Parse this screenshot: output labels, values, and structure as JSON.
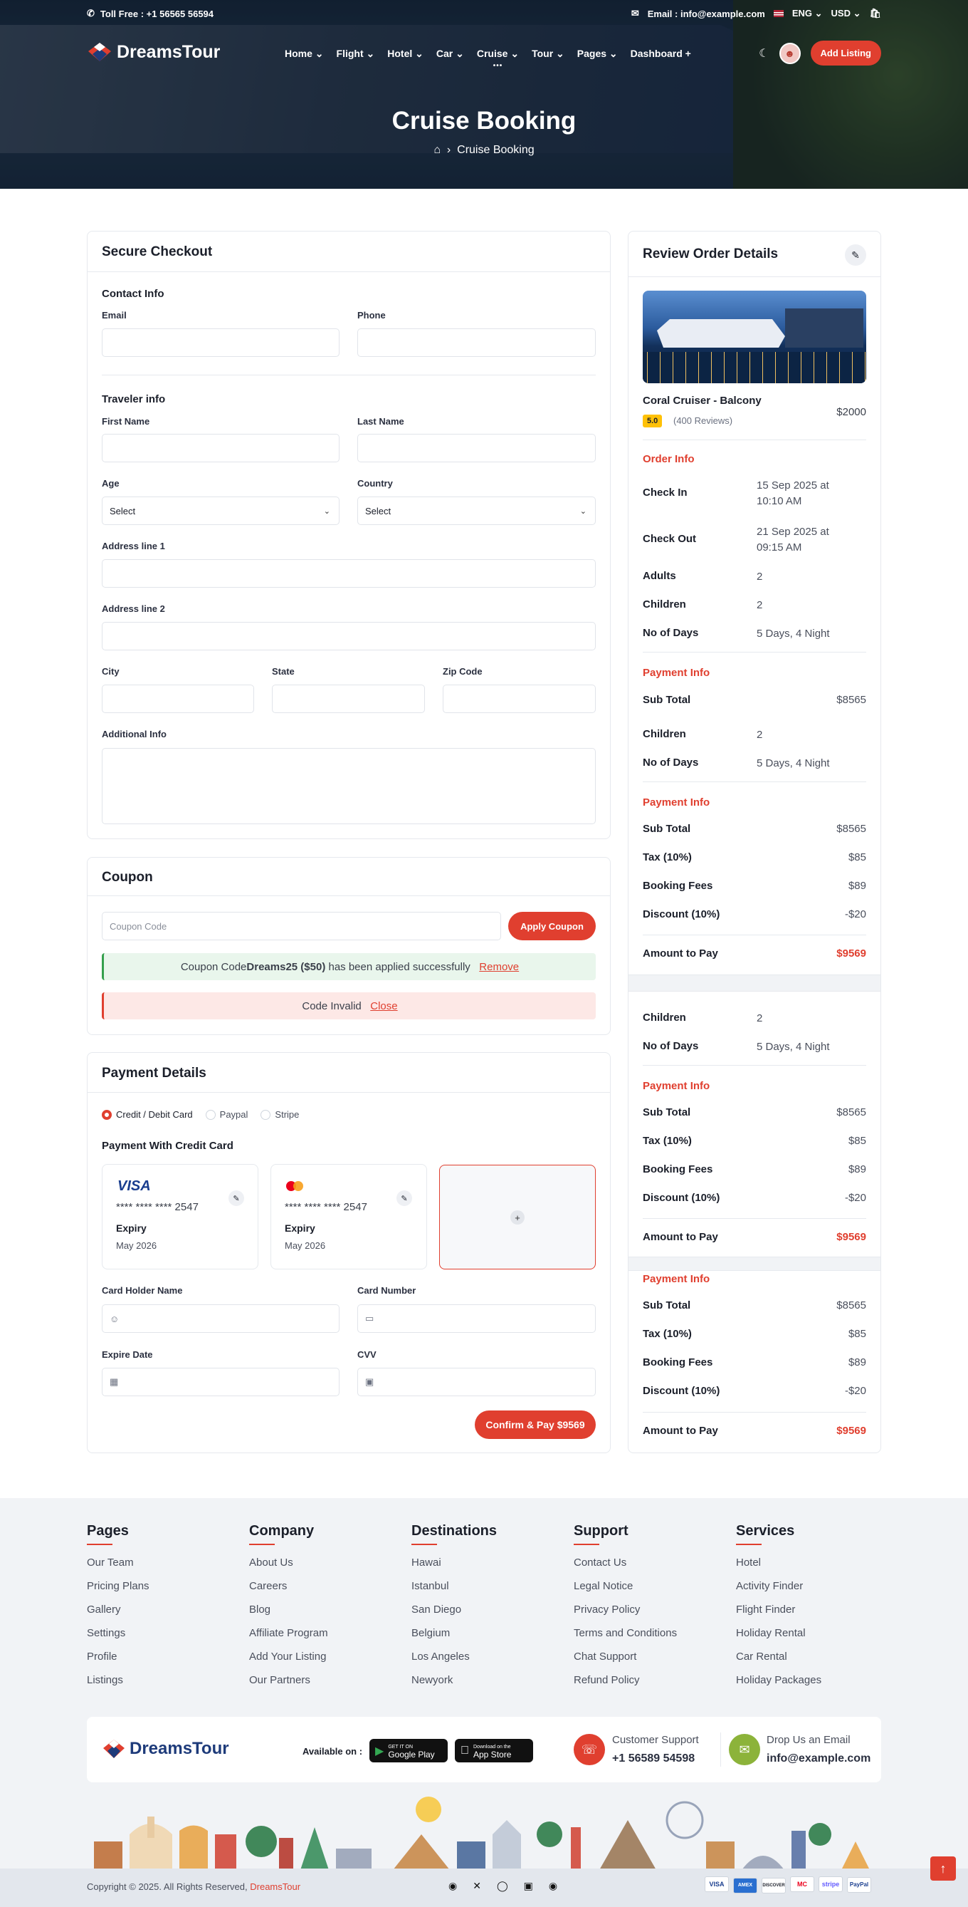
{
  "topbar": {
    "phone": "Toll Free : +1 56565 56594",
    "email": "Email : info@example.com",
    "language": "ENG",
    "currency": "USD"
  },
  "header": {
    "logo": "DreamsTour",
    "menu": [
      "Home",
      "Flight",
      "Hotel",
      "Car",
      "Cruise",
      "Tour",
      "Pages",
      "Dashboard"
    ],
    "add_listing": "Add Listing"
  },
  "hero": {
    "title": "Cruise Booking",
    "breadcrumb": "Cruise Booking"
  },
  "checkout": {
    "title": "Secure Checkout",
    "contact_title": "Contact Info",
    "email_label": "Email",
    "phone_label": "Phone",
    "traveler_title": "Traveler info",
    "first_name_label": "First Name",
    "last_name_label": "Last Name",
    "age_label": "Age",
    "age_value": "Select",
    "country_label": "Country",
    "country_value": "Select",
    "address1_label": "Address line 1",
    "address2_label": "Address line 2",
    "city_label": "City",
    "state_label": "State",
    "zip_label": "Zip Code",
    "additional_label": "Additional Info"
  },
  "coupon": {
    "title": "Coupon",
    "placeholder": "Coupon Code",
    "apply": "Apply Coupon",
    "success_prefix": "Coupon Code ",
    "success_code": "Dreams25 ($50)",
    "success_suffix": " has been applied successfully",
    "remove": "Remove",
    "invalid": "Code Invalid",
    "close": "Close"
  },
  "payment": {
    "title": "Payment Details",
    "methods": [
      "Credit / Debit Card",
      "Paypal",
      "Stripe"
    ],
    "selected_method": "Credit / Debit Card",
    "subtitle": "Payment With Credit Card",
    "cards": [
      {
        "brand": "VISA",
        "number": "**** **** **** 2547",
        "expiry_label": "Expiry",
        "expiry": "May 2026"
      },
      {
        "brand": "mastercard",
        "number": "**** **** **** 2547",
        "expiry_label": "Expiry",
        "expiry": "May 2026"
      }
    ],
    "holder_label": "Card Holder Name",
    "number_label": "Card Number",
    "expire_label": "Expire Date",
    "cvv_label": "CVV",
    "confirm": "Confirm & Pay $9569"
  },
  "order": {
    "title": "Review Order Details",
    "name": "Coral Cruiser - Balcony",
    "rating": "5.0",
    "reviews": "(400 Reviews)",
    "price": "$2000",
    "order_info_title": "Order Info",
    "checkin_label": "Check In",
    "checkin_value": "15 Sep 2025 at 10:10 AM",
    "checkout_label": "Check Out",
    "checkout_value": "21 Sep 2025 at 09:15 AM",
    "adults_label": "Adults",
    "adults_value": "2",
    "children_label": "Children",
    "children_value": "2",
    "days_label": "No of Days",
    "days_value": "5 Days, 4 Night",
    "payment_info_title": "Payment Info",
    "subtotal_label": "Sub Total",
    "subtotal_value": "$8565",
    "tax_label": "Tax (10%)",
    "tax_value": "$85",
    "fees_label": "Booking Fees",
    "fees_value": "$89",
    "discount_label": "Discount (10%)",
    "discount_value": "-$20",
    "amount_label": "Amount to Pay",
    "amount_value": "$9569"
  },
  "footer": {
    "columns": [
      {
        "title": "Pages",
        "items": [
          "Our Team",
          "Pricing Plans",
          "Gallery",
          "Settings",
          "Profile",
          "Listings"
        ]
      },
      {
        "title": "Company",
        "items": [
          "About Us",
          "Careers",
          "Blog",
          "Affiliate Program",
          "Add Your Listing",
          "Our Partners"
        ]
      },
      {
        "title": "Destinations",
        "items": [
          "Hawai",
          "Istanbul",
          "San Diego",
          "Belgium",
          "Los Angeles",
          "Newyork"
        ]
      },
      {
        "title": "Support",
        "items": [
          "Contact Us",
          "Legal Notice",
          "Privacy Policy",
          "Terms and Conditions",
          "Chat Support",
          "Refund Policy"
        ]
      },
      {
        "title": "Services",
        "items": [
          "Hotel",
          "Activity Finder",
          "Flight Finder",
          "Holiday Rental",
          "Car Rental",
          "Holiday Packages"
        ]
      }
    ],
    "logo": "DreamsTour",
    "available_on": "Available on :",
    "google_play_small": "GET IT ON",
    "google_play": "Google Play",
    "app_store_small": "Download on the",
    "app_store": "App Store",
    "support_label": "Customer Support",
    "support_value": "+1 56589 54598",
    "email_label": "Drop Us an Email",
    "email_value": "info@example.com",
    "copyright_prefix": "Copyright © 2025. All Rights Reserved, ",
    "copyright_brand": "DreamsTour",
    "payment_icons": [
      "VISA",
      "AMEX",
      "DISCOVER",
      "MC",
      "stripe",
      "PayPal"
    ]
  },
  "colors": {
    "accent": "#e03f2f",
    "success_bg": "#e9f6ec",
    "error_bg": "#fde8e6",
    "footer_bg": "#f1f3f6",
    "rating_bg": "#ffc107"
  }
}
